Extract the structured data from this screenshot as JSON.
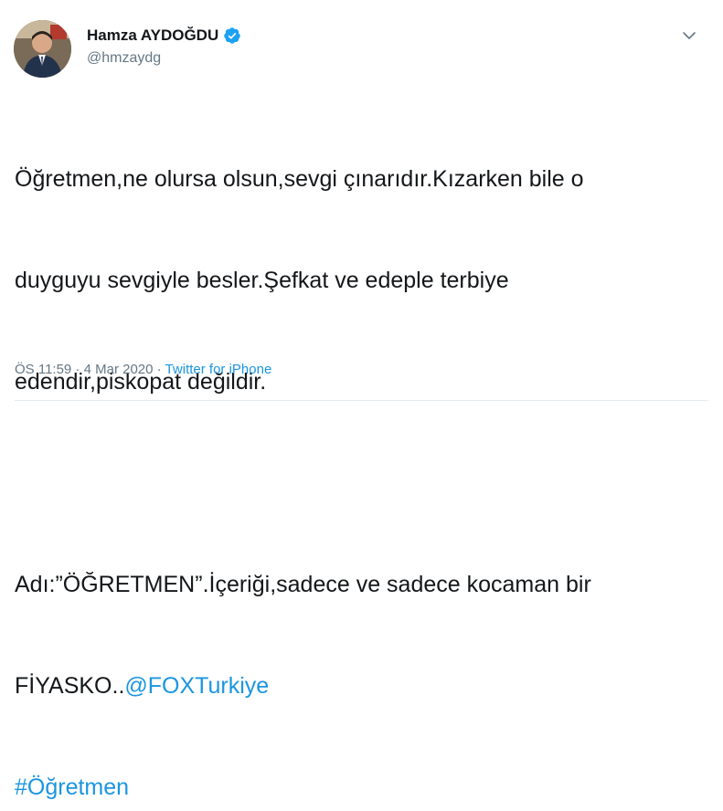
{
  "author": {
    "name": "Hamza AYDOĞDU",
    "handle": "@hmzaydg",
    "verified": true
  },
  "tweet": {
    "para1_line1": "Öğretmen,ne olursa olsun,sevgi çınarıdır.Kızarken bile o",
    "para1_line2": "duyguyu sevgiyle besler.Şefkat ve edeple terbiye",
    "para1_line3": "edendir,piskopat değildir.",
    "para2_line1": "Adı:”ÖĞRETMEN”.İçeriği,sadece ve sadece kocaman bir",
    "para2_line2_text": "FİYASKO..",
    "mention": "@FOXTurkiye",
    "hashtag": "#Öğretmen"
  },
  "meta": {
    "time": "ÖS 11:59",
    "sep1": " · ",
    "date": "4 Mar 2020",
    "sep2": " · ",
    "source": "Twitter for iPhone"
  },
  "colors": {
    "link": "#1b95e0",
    "verified": "#1da1f2",
    "muted": "#657786"
  },
  "icons": [
    "avatar-photo",
    "verified-badge-icon",
    "chevron-down-icon"
  ]
}
